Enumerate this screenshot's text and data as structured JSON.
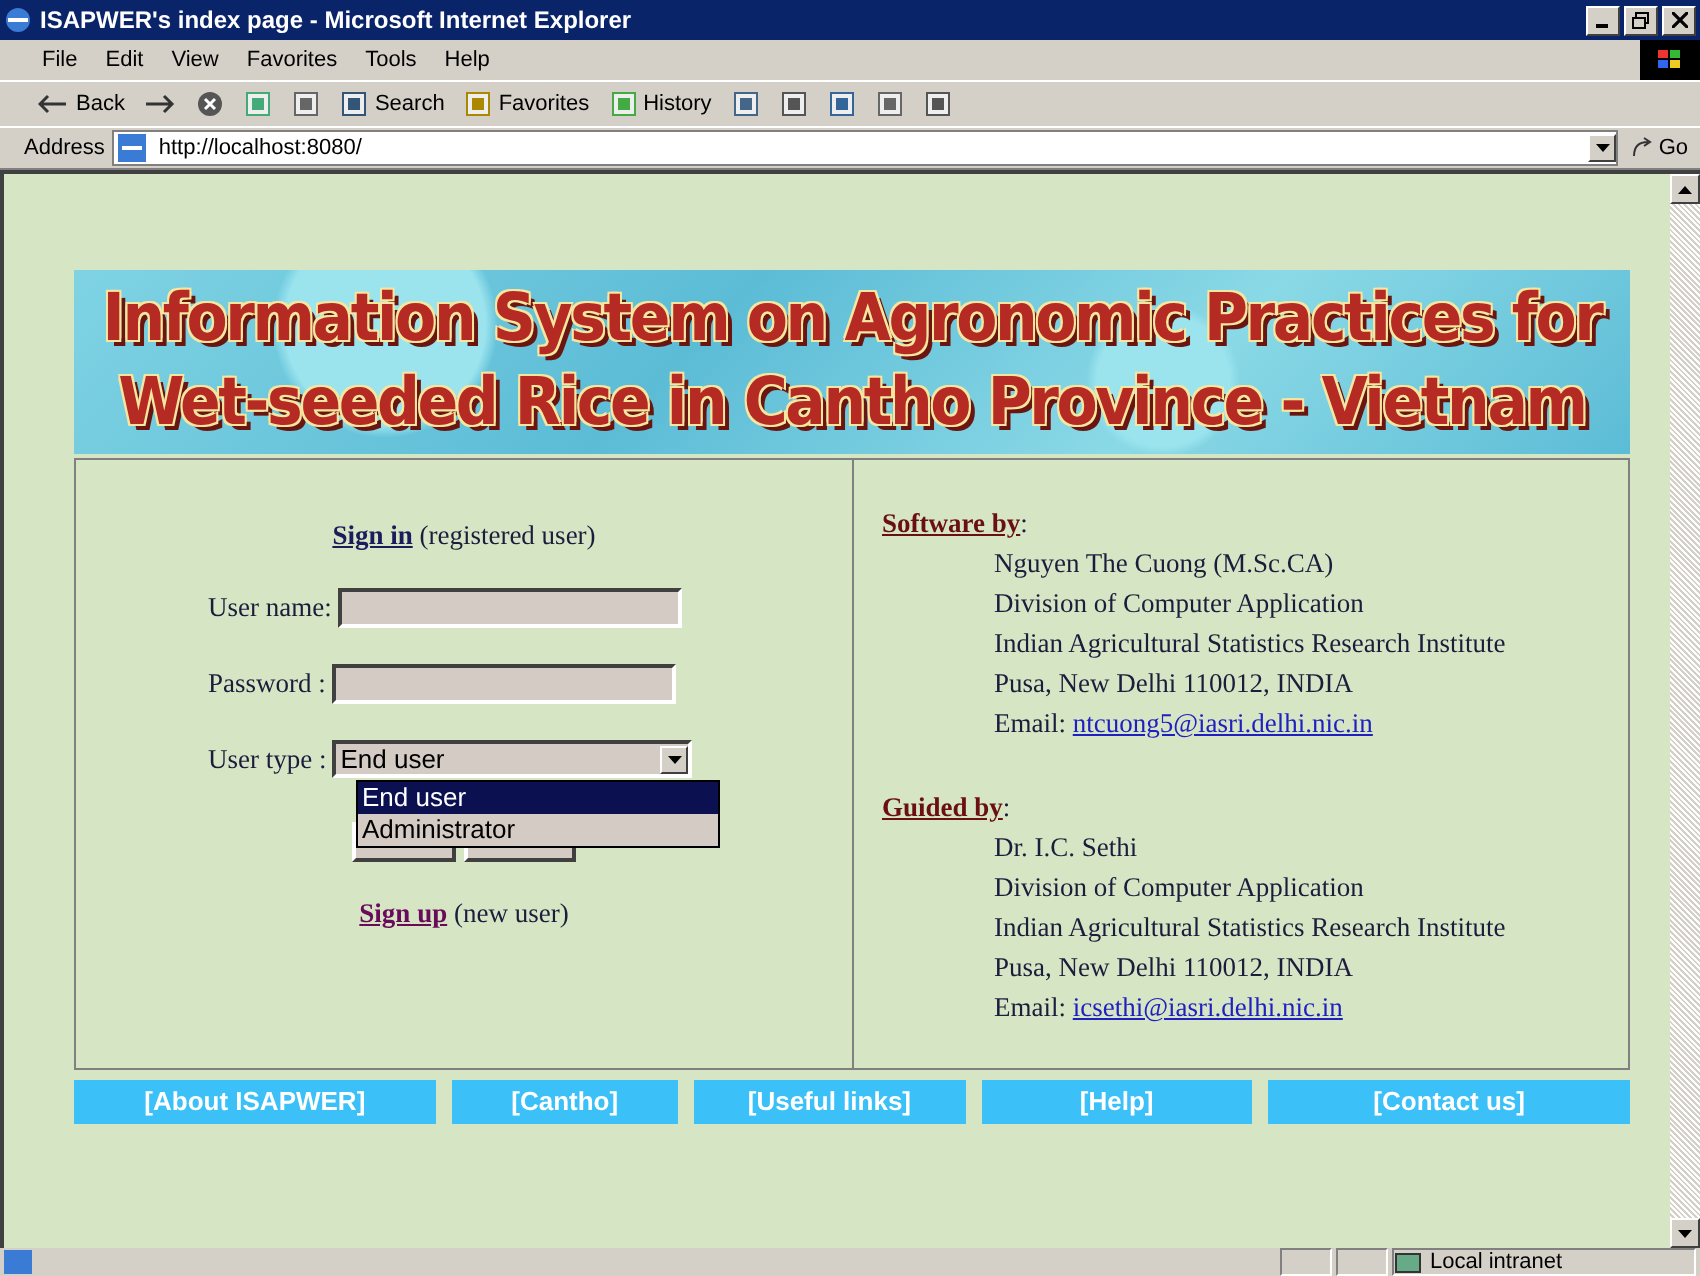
{
  "window": {
    "title": "ISAPWER's index page - Microsoft Internet Explorer"
  },
  "menu": [
    "File",
    "Edit",
    "View",
    "Favorites",
    "Tools",
    "Help"
  ],
  "toolbar": [
    {
      "kind": "back",
      "label": "Back"
    },
    {
      "kind": "forward"
    },
    {
      "kind": "stop"
    },
    {
      "kind": "refresh"
    },
    {
      "kind": "home"
    },
    {
      "kind": "search",
      "label": "Search"
    },
    {
      "kind": "favorites",
      "label": "Favorites"
    },
    {
      "kind": "history",
      "label": "History"
    },
    {
      "kind": "mail"
    },
    {
      "kind": "print"
    },
    {
      "kind": "edit"
    },
    {
      "kind": "discuss"
    },
    {
      "kind": "messenger"
    }
  ],
  "address": {
    "label": "Address",
    "value": "http://localhost:8080/",
    "go": "Go"
  },
  "banner": [
    "Information System on Agronomic Practices for",
    "Wet-seeded Rice in Cantho Province - Vietnam"
  ],
  "login": {
    "signin_link": "Sign in",
    "signin_note": "(registered user)",
    "username_label": "User name:",
    "password_label": "Password :",
    "usertype_label": "User type :",
    "usertype_value": "End user",
    "options": [
      {
        "label": "End user",
        "selected": true
      },
      {
        "label": "Administrator",
        "selected": false
      }
    ],
    "signup_link": "Sign up",
    "signup_note": "(new user)"
  },
  "credits": [
    {
      "heading": "Software by",
      "colon": ":",
      "lines": [
        "Nguyen The Cuong (M.Sc.CA)",
        "Division of Computer Application",
        "Indian Agricultural Statistics Research Institute",
        "Pusa, New Delhi 110012, INDIA"
      ],
      "email_label": "Email:",
      "email": "ntcuong5@iasri.delhi.nic.in"
    },
    {
      "heading": "Guided by",
      "colon": ":",
      "lines": [
        "Dr. I.C. Sethi",
        "Division of Computer Application",
        "Indian Agricultural Statistics Research Institute",
        "Pusa, New Delhi 110012, INDIA"
      ],
      "email_label": "Email:",
      "email": "icsethi@iasri.delhi.nic.in"
    }
  ],
  "nav": [
    "[About ISAPWER]",
    "[Cantho]",
    "[Useful links]",
    "[Help]",
    "[Contact us]"
  ],
  "status_bar": {
    "zone": "Local intranet"
  }
}
